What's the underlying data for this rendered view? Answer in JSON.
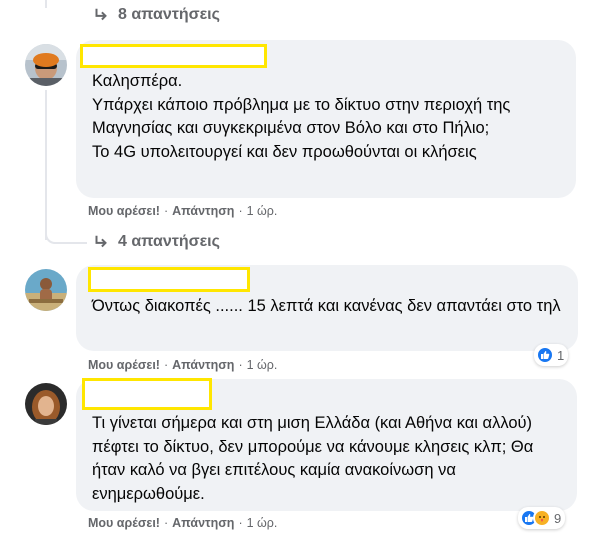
{
  "top_replies": {
    "label": "8 απαντήσεις"
  },
  "comments": [
    {
      "text": "Καλησπέρα.\nΥπάρχει κάποιο πρόβλημα με το δίκτυο στην περιοχή της Μαγνησίας και συγκεκριμένα στον Βόλο και στο Πήλιο;\nΤο 4G υπολειτουργεί και δεν προωθούνται οι κλήσεις",
      "like": "Μου αρέσει!",
      "reply": "Απάντηση",
      "time": "1 ώρ.",
      "replies": "4 απαντήσεις"
    },
    {
      "text": "Όντως διακοπές ...... 15 λεπτά και κανένας δεν απαντάει στο τηλ",
      "like": "Μου αρέσει!",
      "reply": "Απάντηση",
      "time": "1 ώρ.",
      "reaction_count": "1"
    },
    {
      "text": "Τι γίνεται σήμερα και στη μιση Ελλάδα (και Αθήνα και αλλού) πέφτει το δίκτυο, δεν μπορούμε να κάνουμε κλησεις κλπ; Θα ήταν καλό να βγει επιτέλους καμία ανακοίνωση να ενημερωθούμε.",
      "like": "Μου αρέσει!",
      "reply": "Απάντηση",
      "time": "1 ώρ.",
      "reaction_count": "9"
    }
  ],
  "icons": {
    "reply_arrow": "reply-arrow-icon",
    "like_reaction": "like-reaction-icon",
    "care_reaction": "care-reaction-icon"
  },
  "colors": {
    "bubble": "#f0f2f5",
    "secondary_text": "#65676b",
    "like_blue": "#1877f2",
    "redaction": "#ffe600"
  }
}
